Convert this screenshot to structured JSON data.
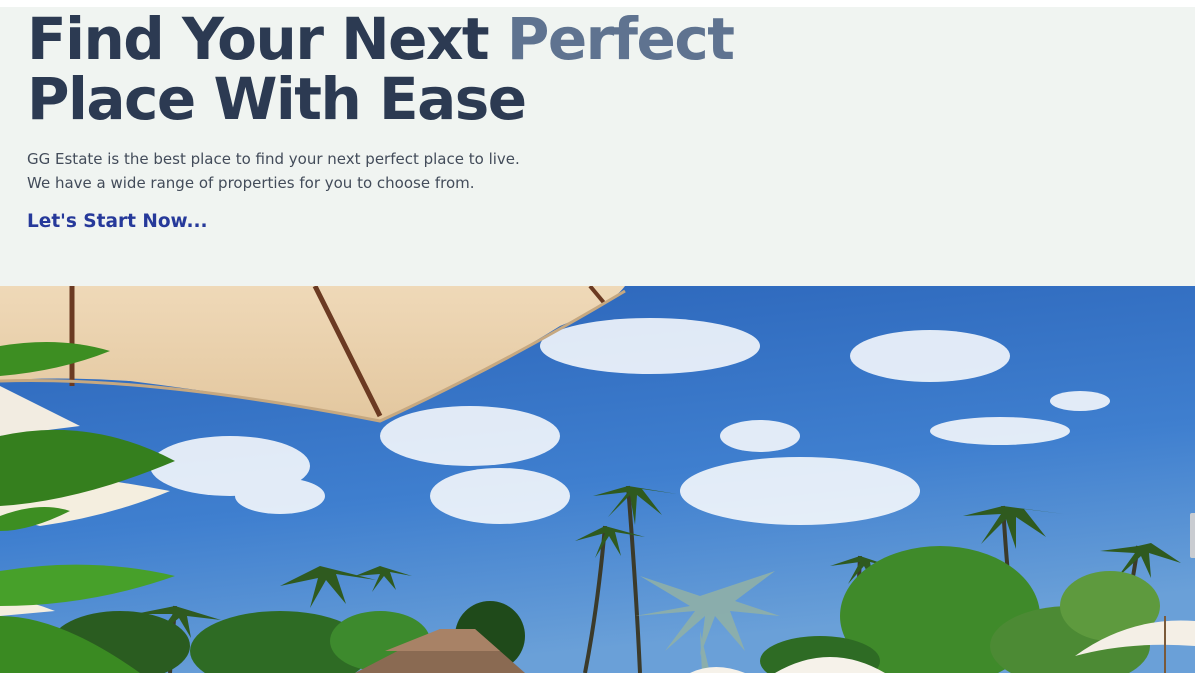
{
  "hero": {
    "headline_part1": "Find Your Next ",
    "headline_accent": "Perfect",
    "headline_line2": "Place With Ease",
    "description_line1": "GG Estate is the best place to find your next perfect place to live.",
    "description_line2": "We have a wide range of properties for you to choose from.",
    "cta_label": "Let's Start Now..."
  },
  "colors": {
    "background": "#f0f4f1",
    "headline": "#2c3a52",
    "accent": "#5f7390",
    "text": "#434c5a",
    "cta": "#26399a"
  },
  "banner": {
    "icon": "resort-photo"
  }
}
